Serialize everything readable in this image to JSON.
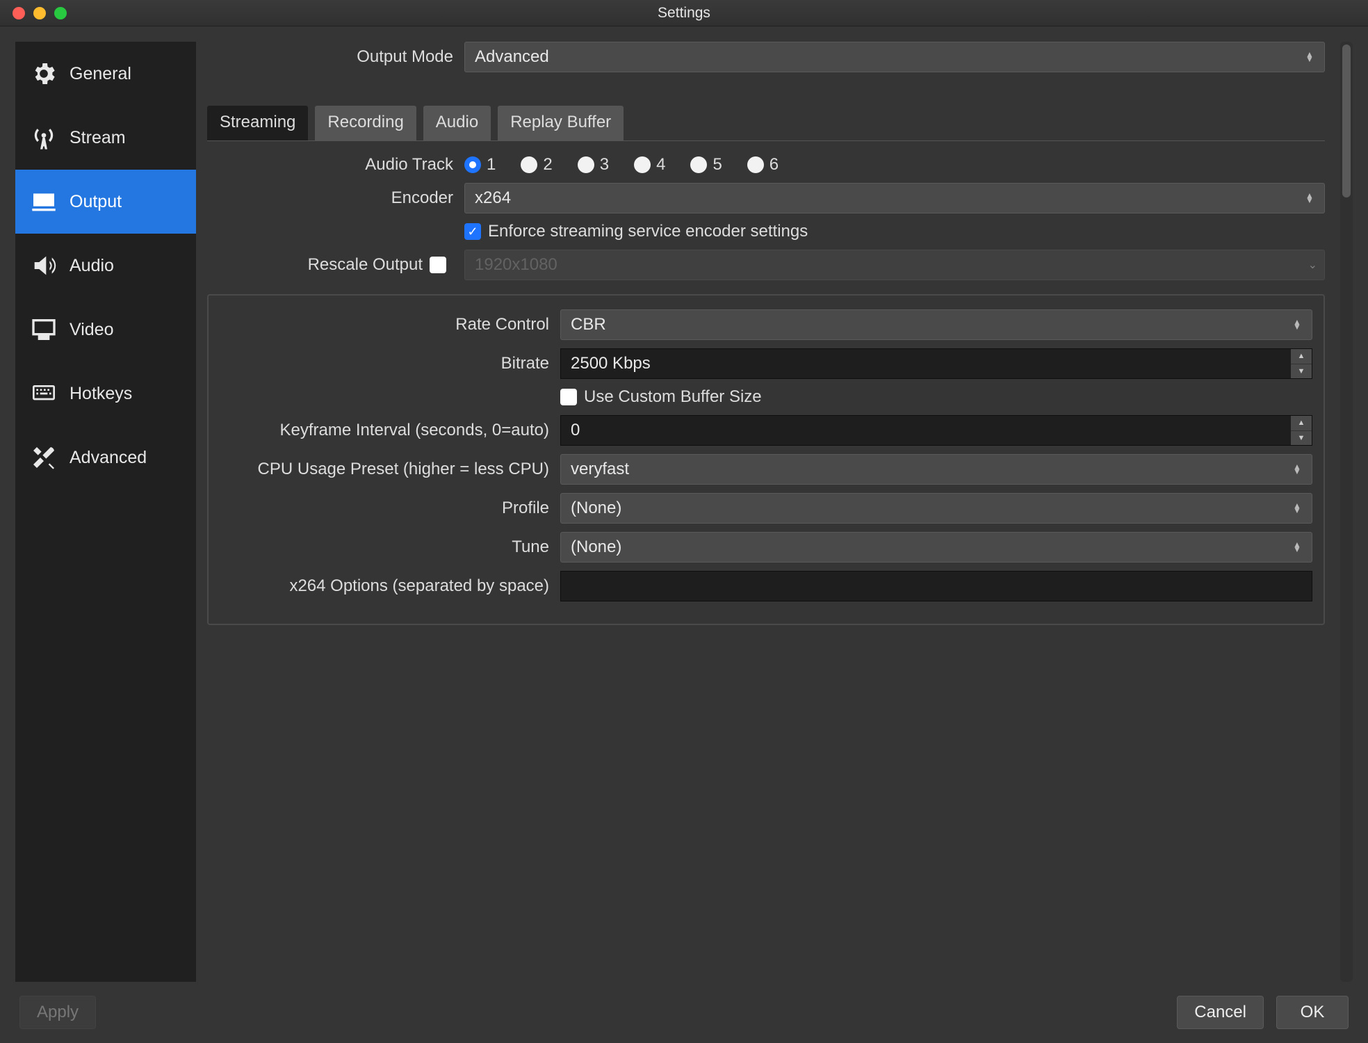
{
  "window": {
    "title": "Settings"
  },
  "sidebar": {
    "items": [
      {
        "label": "General"
      },
      {
        "label": "Stream"
      },
      {
        "label": "Output"
      },
      {
        "label": "Audio"
      },
      {
        "label": "Video"
      },
      {
        "label": "Hotkeys"
      },
      {
        "label": "Advanced"
      }
    ],
    "active_index": 2
  },
  "output_mode": {
    "label": "Output Mode",
    "value": "Advanced"
  },
  "tabs": {
    "items": [
      {
        "label": "Streaming"
      },
      {
        "label": "Recording"
      },
      {
        "label": "Audio"
      },
      {
        "label": "Replay Buffer"
      }
    ],
    "active_index": 0
  },
  "audio_track": {
    "label": "Audio Track",
    "options": [
      "1",
      "2",
      "3",
      "4",
      "5",
      "6"
    ],
    "selected": "1"
  },
  "encoder": {
    "label": "Encoder",
    "value": "x264"
  },
  "enforce": {
    "label": "Enforce streaming service encoder settings",
    "checked": true
  },
  "rescale": {
    "label": "Rescale Output",
    "checked": false,
    "value": "1920x1080"
  },
  "encoder_settings": {
    "rate_control": {
      "label": "Rate Control",
      "value": "CBR"
    },
    "bitrate": {
      "label": "Bitrate",
      "value": "2500 Kbps"
    },
    "custom_buffer": {
      "label": "Use Custom Buffer Size",
      "checked": false
    },
    "keyframe": {
      "label": "Keyframe Interval (seconds, 0=auto)",
      "value": "0"
    },
    "cpu_preset": {
      "label": "CPU Usage Preset (higher = less CPU)",
      "value": "veryfast"
    },
    "profile": {
      "label": "Profile",
      "value": "(None)"
    },
    "tune": {
      "label": "Tune",
      "value": "(None)"
    },
    "x264opts": {
      "label": "x264 Options (separated by space)",
      "value": ""
    }
  },
  "footer": {
    "apply": "Apply",
    "cancel": "Cancel",
    "ok": "OK"
  }
}
